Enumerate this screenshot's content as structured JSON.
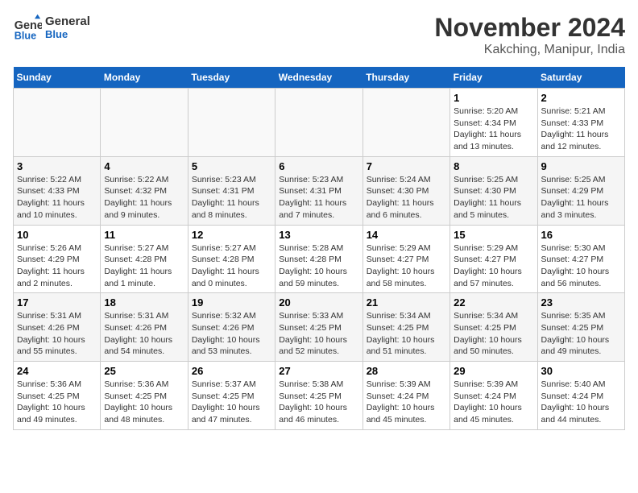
{
  "header": {
    "logo_line1": "General",
    "logo_line2": "Blue",
    "month": "November 2024",
    "location": "Kakching, Manipur, India"
  },
  "weekdays": [
    "Sunday",
    "Monday",
    "Tuesday",
    "Wednesday",
    "Thursday",
    "Friday",
    "Saturday"
  ],
  "weeks": [
    [
      {
        "num": "",
        "info": ""
      },
      {
        "num": "",
        "info": ""
      },
      {
        "num": "",
        "info": ""
      },
      {
        "num": "",
        "info": ""
      },
      {
        "num": "",
        "info": ""
      },
      {
        "num": "1",
        "info": "Sunrise: 5:20 AM\nSunset: 4:34 PM\nDaylight: 11 hours and 13 minutes."
      },
      {
        "num": "2",
        "info": "Sunrise: 5:21 AM\nSunset: 4:33 PM\nDaylight: 11 hours and 12 minutes."
      }
    ],
    [
      {
        "num": "3",
        "info": "Sunrise: 5:22 AM\nSunset: 4:33 PM\nDaylight: 11 hours and 10 minutes."
      },
      {
        "num": "4",
        "info": "Sunrise: 5:22 AM\nSunset: 4:32 PM\nDaylight: 11 hours and 9 minutes."
      },
      {
        "num": "5",
        "info": "Sunrise: 5:23 AM\nSunset: 4:31 PM\nDaylight: 11 hours and 8 minutes."
      },
      {
        "num": "6",
        "info": "Sunrise: 5:23 AM\nSunset: 4:31 PM\nDaylight: 11 hours and 7 minutes."
      },
      {
        "num": "7",
        "info": "Sunrise: 5:24 AM\nSunset: 4:30 PM\nDaylight: 11 hours and 6 minutes."
      },
      {
        "num": "8",
        "info": "Sunrise: 5:25 AM\nSunset: 4:30 PM\nDaylight: 11 hours and 5 minutes."
      },
      {
        "num": "9",
        "info": "Sunrise: 5:25 AM\nSunset: 4:29 PM\nDaylight: 11 hours and 3 minutes."
      }
    ],
    [
      {
        "num": "10",
        "info": "Sunrise: 5:26 AM\nSunset: 4:29 PM\nDaylight: 11 hours and 2 minutes."
      },
      {
        "num": "11",
        "info": "Sunrise: 5:27 AM\nSunset: 4:28 PM\nDaylight: 11 hours and 1 minute."
      },
      {
        "num": "12",
        "info": "Sunrise: 5:27 AM\nSunset: 4:28 PM\nDaylight: 11 hours and 0 minutes."
      },
      {
        "num": "13",
        "info": "Sunrise: 5:28 AM\nSunset: 4:28 PM\nDaylight: 10 hours and 59 minutes."
      },
      {
        "num": "14",
        "info": "Sunrise: 5:29 AM\nSunset: 4:27 PM\nDaylight: 10 hours and 58 minutes."
      },
      {
        "num": "15",
        "info": "Sunrise: 5:29 AM\nSunset: 4:27 PM\nDaylight: 10 hours and 57 minutes."
      },
      {
        "num": "16",
        "info": "Sunrise: 5:30 AM\nSunset: 4:27 PM\nDaylight: 10 hours and 56 minutes."
      }
    ],
    [
      {
        "num": "17",
        "info": "Sunrise: 5:31 AM\nSunset: 4:26 PM\nDaylight: 10 hours and 55 minutes."
      },
      {
        "num": "18",
        "info": "Sunrise: 5:31 AM\nSunset: 4:26 PM\nDaylight: 10 hours and 54 minutes."
      },
      {
        "num": "19",
        "info": "Sunrise: 5:32 AM\nSunset: 4:26 PM\nDaylight: 10 hours and 53 minutes."
      },
      {
        "num": "20",
        "info": "Sunrise: 5:33 AM\nSunset: 4:25 PM\nDaylight: 10 hours and 52 minutes."
      },
      {
        "num": "21",
        "info": "Sunrise: 5:34 AM\nSunset: 4:25 PM\nDaylight: 10 hours and 51 minutes."
      },
      {
        "num": "22",
        "info": "Sunrise: 5:34 AM\nSunset: 4:25 PM\nDaylight: 10 hours and 50 minutes."
      },
      {
        "num": "23",
        "info": "Sunrise: 5:35 AM\nSunset: 4:25 PM\nDaylight: 10 hours and 49 minutes."
      }
    ],
    [
      {
        "num": "24",
        "info": "Sunrise: 5:36 AM\nSunset: 4:25 PM\nDaylight: 10 hours and 49 minutes."
      },
      {
        "num": "25",
        "info": "Sunrise: 5:36 AM\nSunset: 4:25 PM\nDaylight: 10 hours and 48 minutes."
      },
      {
        "num": "26",
        "info": "Sunrise: 5:37 AM\nSunset: 4:25 PM\nDaylight: 10 hours and 47 minutes."
      },
      {
        "num": "27",
        "info": "Sunrise: 5:38 AM\nSunset: 4:25 PM\nDaylight: 10 hours and 46 minutes."
      },
      {
        "num": "28",
        "info": "Sunrise: 5:39 AM\nSunset: 4:24 PM\nDaylight: 10 hours and 45 minutes."
      },
      {
        "num": "29",
        "info": "Sunrise: 5:39 AM\nSunset: 4:24 PM\nDaylight: 10 hours and 45 minutes."
      },
      {
        "num": "30",
        "info": "Sunrise: 5:40 AM\nSunset: 4:24 PM\nDaylight: 10 hours and 44 minutes."
      }
    ]
  ]
}
